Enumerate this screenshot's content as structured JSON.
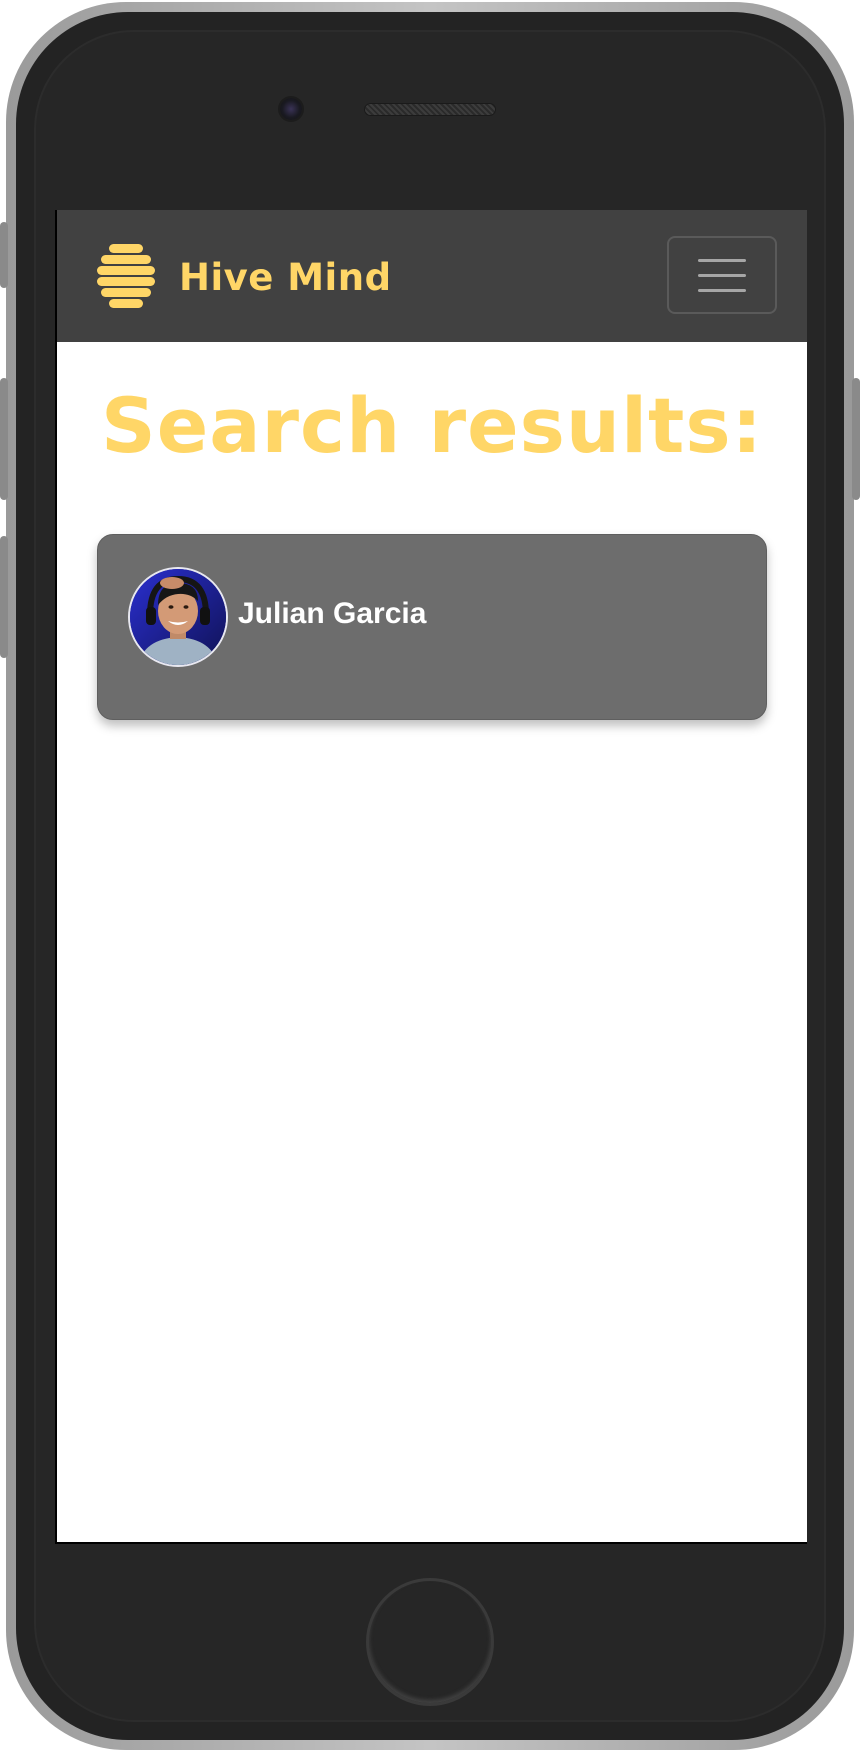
{
  "app": {
    "brand_name": "Hive Mind",
    "accent_color": "#ffd667",
    "navbar_color": "#414141"
  },
  "icons": {
    "brand": "hive-icon",
    "menu": "hamburger-menu-icon"
  },
  "page": {
    "title": "Search results:"
  },
  "results": [
    {
      "name": "Julian Garcia",
      "avatar": "profile-photo"
    }
  ]
}
